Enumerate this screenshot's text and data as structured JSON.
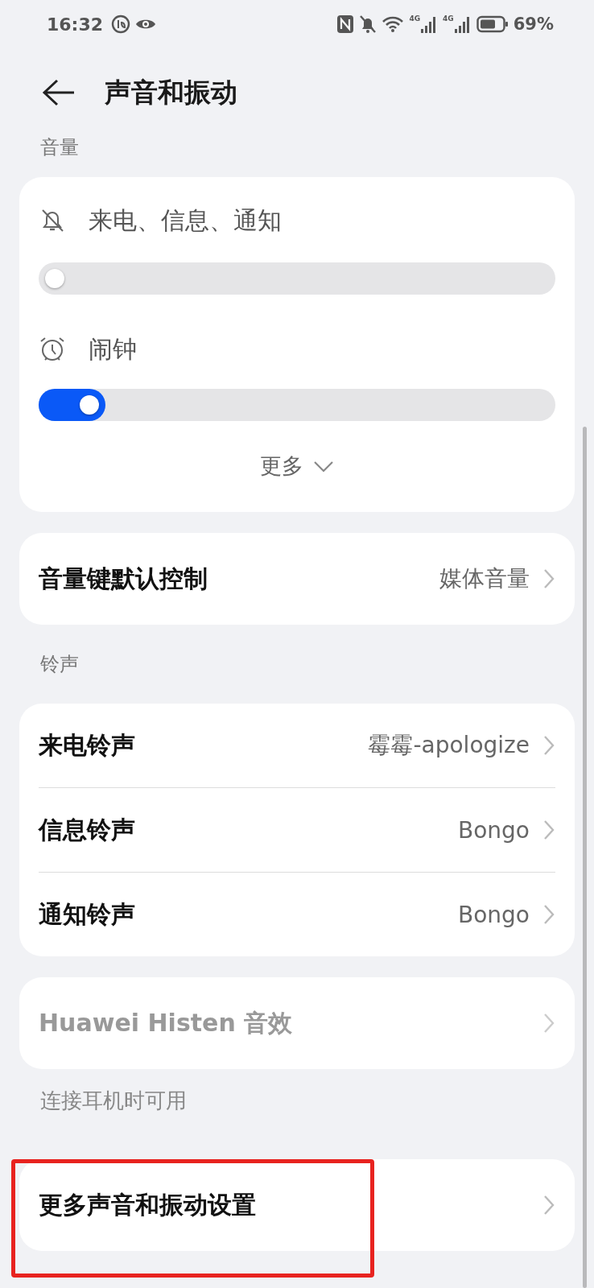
{
  "status_bar": {
    "time": "16:32",
    "networks": [
      "4G",
      "4G"
    ],
    "battery": "69%"
  },
  "header": {
    "title": "声音和振动"
  },
  "volume": {
    "label": "音量",
    "sliders": [
      {
        "kind": "ringer",
        "label": "来电、信息、通知",
        "level": 0
      },
      {
        "kind": "alarm",
        "label": "闹钟",
        "level": 0.13
      }
    ],
    "more": {
      "label": "更多",
      "expanded": false
    }
  },
  "volume_key": {
    "label": "音量键默认控制",
    "value": "媒体音量"
  },
  "ringtones": {
    "label": "铃声",
    "items": [
      {
        "label": "来电铃声",
        "value": "霉霉-apologize"
      },
      {
        "label": "信息铃声",
        "value": "Bongo"
      },
      {
        "label": "通知铃声",
        "value": "Bongo"
      }
    ]
  },
  "histen": {
    "label": "Huawei Histen 音效",
    "disabled": true,
    "caption": "连接耳机时可用"
  },
  "more_settings": {
    "label": "更多声音和振动设置",
    "highlighted": true
  }
}
